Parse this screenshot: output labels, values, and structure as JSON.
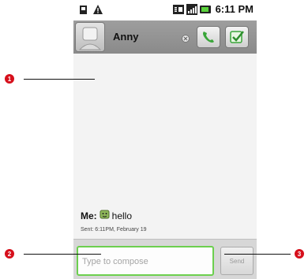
{
  "status_bar": {
    "left_icons": [
      "sim-card-icon",
      "warning-icon"
    ],
    "right_icons": [
      "3g-icon",
      "signal-icon",
      "battery-icon"
    ],
    "time": "6:11 PM"
  },
  "header": {
    "contact_name": "Anny",
    "presence_icon": "close-circle-icon",
    "buttons": [
      "call-icon",
      "check-icon"
    ]
  },
  "thread": {
    "messages": [
      {
        "sender": "Me:",
        "emoji": "smiley-emoticon-icon",
        "text": "hello",
        "meta": "Sent: 6:11PM, February 19"
      }
    ]
  },
  "compose": {
    "placeholder": "Type to compose",
    "send_label": "Send"
  },
  "callouts": [
    "1",
    "2",
    "3"
  ],
  "colors": {
    "callout": "#d60f1b",
    "compose_focus": "#6ccf4e",
    "header_bg": "#949494",
    "call_green": "#3aa63a"
  }
}
